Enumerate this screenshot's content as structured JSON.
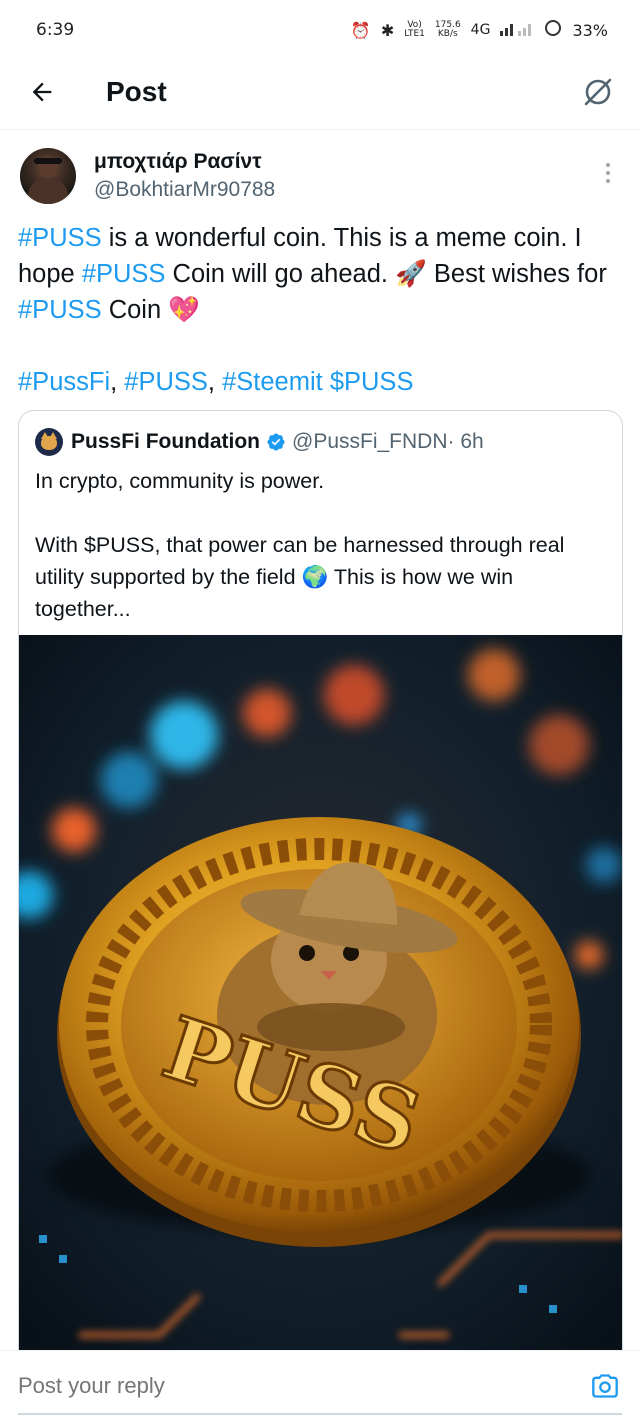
{
  "status_bar": {
    "time": "6:39",
    "network_top": "Vo)",
    "network_bottom": "LTE1",
    "speed_top": "175.6",
    "speed_bottom": "KB/s",
    "network_type": "4G",
    "battery": "33%"
  },
  "header": {
    "title": "Post"
  },
  "tweet": {
    "author_name": "μποχτιάρ Ρασίντ",
    "author_handle": "@BokhtiarMr90788",
    "body": {
      "s1_tag": "#PUSS",
      "s1_text": " is a wonderful coin. This is a meme coin. I hope ",
      "s2_tag": "#PUSS",
      "s2_text": " Coin will go ahead. 🚀 Best wishes for ",
      "s3_tag": "#PUSS",
      "s3_text": " Coin 💖"
    },
    "tags": {
      "t1": "#PussFi",
      "sep1": ", ",
      "t2": "#PUSS",
      "sep2": ", ",
      "t3": "#Steemit",
      "sep3": " ",
      "t4": "$PUSS"
    }
  },
  "quote": {
    "author_name": "PussFi Foundation",
    "author_handle": "@PussFi_FNDN",
    "time": " · 6h",
    "paragraph1": "In crypto, community is power.",
    "paragraph2": "With $PUSS, that power can be harnessed through real utility supported by the field 🌍 This is how we win together...",
    "image_alt": "Golden PUSS coin with a cat wearing a cowboy hat",
    "coin_text": "PUSS"
  },
  "reply": {
    "placeholder": "Post your reply"
  },
  "colors": {
    "link": "#1d9bf0",
    "secondary_text": "#536471",
    "border": "#cfd9de"
  }
}
